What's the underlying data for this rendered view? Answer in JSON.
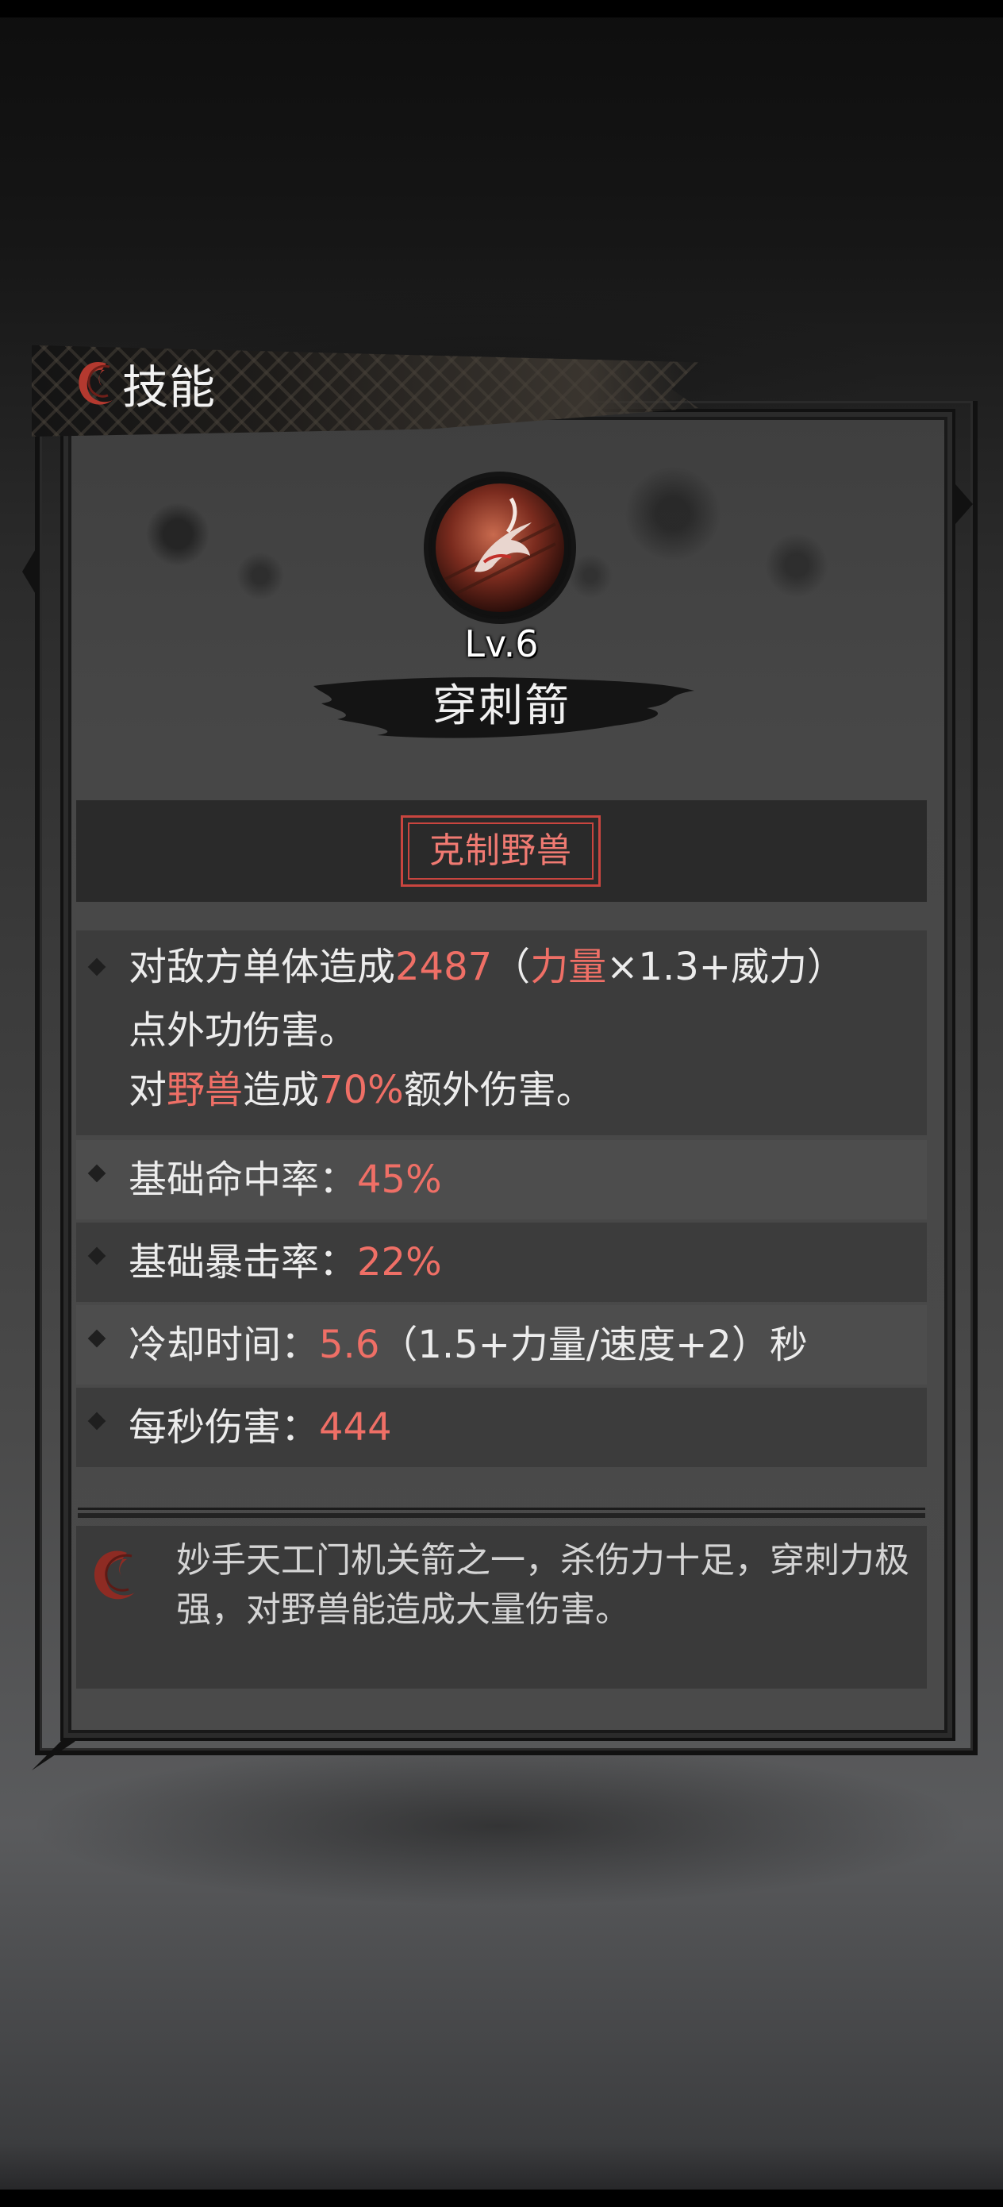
{
  "dialog": {
    "title": "技能"
  },
  "skill": {
    "level_label": "Lv.6",
    "name": "穿刺箭",
    "counter_tag": "克制野兽"
  },
  "effects": {
    "line1": {
      "prefix": "对敌方单体造成",
      "damage": "2487",
      "open": "（",
      "stat": "力量",
      "formula": "×1.3+威力）"
    },
    "line2": "点外功伤害。",
    "line3": {
      "prefix": "对",
      "target": "野兽",
      "mid": "造成",
      "bonus": "70%",
      "suffix": "额外伤害。"
    }
  },
  "stats": [
    {
      "label": "基础命中率：",
      "value": "45%",
      "extra": ""
    },
    {
      "label": "基础暴击率：",
      "value": "22%",
      "extra": ""
    },
    {
      "label": "冷却时间：",
      "value": "5.6",
      "extra": "（1.5+力量/速度+2）秒"
    },
    {
      "label": "每秒伤害：",
      "value": "444",
      "extra": ""
    }
  ],
  "description": "妙手天工门机关箭之一，杀伤力十足，穿刺力极强，对野兽能造成大量伤害。",
  "colors": {
    "highlight": "#ef6f66",
    "text": "#ececec",
    "panel": "#474747"
  },
  "icons": {
    "title_emblem": "swirl-emblem-icon",
    "skill_icon": "piercing-arrow-skill-icon",
    "bullet": "diamond-bullet-icon",
    "desc_emblem": "swirl-emblem-icon"
  }
}
